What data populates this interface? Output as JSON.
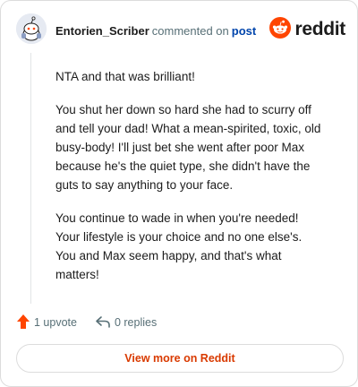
{
  "header": {
    "author": "Entorien_Scriber",
    "verb": "commented on",
    "post_link": "post",
    "logo_text": "reddit",
    "avatar_icon": "snoo-avatar-icon",
    "logo_icon": "reddit-alien-icon"
  },
  "comment": {
    "paragraphs": [
      "NTA and that was brilliant!",
      "You shut her down so hard she had to scurry off and tell your dad! What a mean-spirited, toxic, old busy-body! I'll just bet she went after poor Max because he's the quiet type, she didn't have the guts to say anything to your face.",
      "You continue to wade in when you're needed! Your lifestyle is your choice and no one else's. You and Max seem happy, and that's what matters!"
    ]
  },
  "actions": {
    "upvote_label": "1 upvote",
    "reply_label": "0 replies",
    "upvote_icon": "upvote-arrow-icon",
    "reply_icon": "reply-arrow-icon"
  },
  "footer": {
    "view_more_label": "View more on Reddit"
  },
  "colors": {
    "brand": "#ff4500",
    "link": "#0045ac",
    "view_more": "#d93a00",
    "muted": "#576f76"
  }
}
